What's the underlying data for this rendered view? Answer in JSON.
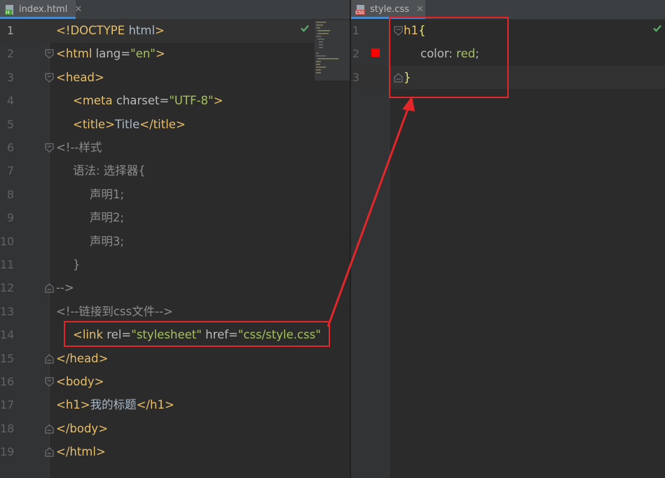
{
  "left_tab": {
    "label": "index.html",
    "icon": "html-file-icon"
  },
  "right_tab": {
    "label": "style.css",
    "icon": "css-file-icon"
  },
  "left_editor": {
    "line_numbers": [
      "1",
      "2",
      "3",
      "4",
      "5",
      "6",
      "7",
      "8",
      "9",
      "10",
      "11",
      "12",
      "13",
      "14",
      "15",
      "16",
      "17",
      "18",
      "19"
    ],
    "lines": [
      {
        "segments": [
          {
            "t": "tag",
            "v": "<!DOCTYPE "
          },
          {
            "t": "txt",
            "v": "html"
          },
          {
            "t": "tag",
            "v": ">"
          }
        ]
      },
      {
        "segments": [
          {
            "t": "tag",
            "v": "<html "
          },
          {
            "t": "attr",
            "v": "lang="
          },
          {
            "t": "val",
            "v": "\"en\""
          },
          {
            "t": "tag",
            "v": ">"
          }
        ]
      },
      {
        "segments": [
          {
            "t": "tag",
            "v": "<head>"
          }
        ]
      },
      {
        "segments": [
          {
            "t": "tag",
            "v": "<meta "
          },
          {
            "t": "attr",
            "v": "charset="
          },
          {
            "t": "val",
            "v": "\"UTF-8\""
          },
          {
            "t": "tag",
            "v": ">"
          }
        ]
      },
      {
        "segments": [
          {
            "t": "tag",
            "v": "<title>"
          },
          {
            "t": "txt",
            "v": "Title"
          },
          {
            "t": "tag",
            "v": "</title>"
          }
        ]
      },
      {
        "segments": [
          {
            "t": "cmt",
            "v": "<!--样式"
          }
        ]
      },
      {
        "segments": [
          {
            "t": "cmt",
            "v": "语法: 选择器{"
          }
        ]
      },
      {
        "segments": [
          {
            "t": "cmt",
            "v": "声明1;"
          }
        ]
      },
      {
        "segments": [
          {
            "t": "cmt",
            "v": "声明2;"
          }
        ]
      },
      {
        "segments": [
          {
            "t": "cmt",
            "v": "声明3;"
          }
        ]
      },
      {
        "segments": [
          {
            "t": "cmt",
            "v": "}"
          }
        ]
      },
      {
        "segments": [
          {
            "t": "cmt",
            "v": "-->"
          }
        ]
      },
      {
        "segments": [
          {
            "t": "cmt",
            "v": "<!--链接到css文件-->"
          }
        ]
      },
      {
        "segments": [
          {
            "t": "tag",
            "v": "<link "
          },
          {
            "t": "attr",
            "v": "rel="
          },
          {
            "t": "val",
            "v": "\"stylesheet\" "
          },
          {
            "t": "attr",
            "v": "href="
          },
          {
            "t": "val",
            "v": "\"css/style.css\""
          }
        ]
      },
      {
        "segments": [
          {
            "t": "tag",
            "v": "</head>"
          }
        ]
      },
      {
        "segments": [
          {
            "t": "tag",
            "v": "<body>"
          }
        ]
      },
      {
        "segments": [
          {
            "t": "tag",
            "v": "<h1>"
          },
          {
            "t": "txt",
            "v": "我的标题"
          },
          {
            "t": "tag",
            "v": "</h1>"
          }
        ]
      },
      {
        "segments": [
          {
            "t": "tag",
            "v": "</body>"
          }
        ]
      },
      {
        "segments": [
          {
            "t": "tag",
            "v": "</html>"
          }
        ]
      }
    ]
  },
  "right_editor": {
    "line_numbers": [
      "1",
      "2",
      "3"
    ],
    "lines": [
      {
        "segments": [
          {
            "t": "sel",
            "v": "h1"
          },
          {
            "t": "brace",
            "v": "{"
          }
        ]
      },
      {
        "segments": [
          {
            "t": "prop",
            "v": "color"
          },
          {
            "t": "txt",
            "v": ": "
          },
          {
            "t": "cssval",
            "v": "red"
          },
          {
            "t": "txt",
            "v": ";"
          }
        ]
      },
      {
        "segments": [
          {
            "t": "brace",
            "v": "}"
          }
        ]
      }
    ],
    "color_marker": "#ff0000"
  },
  "annotation_color": "#e3262a",
  "inspection_status": "ok-check-icon"
}
